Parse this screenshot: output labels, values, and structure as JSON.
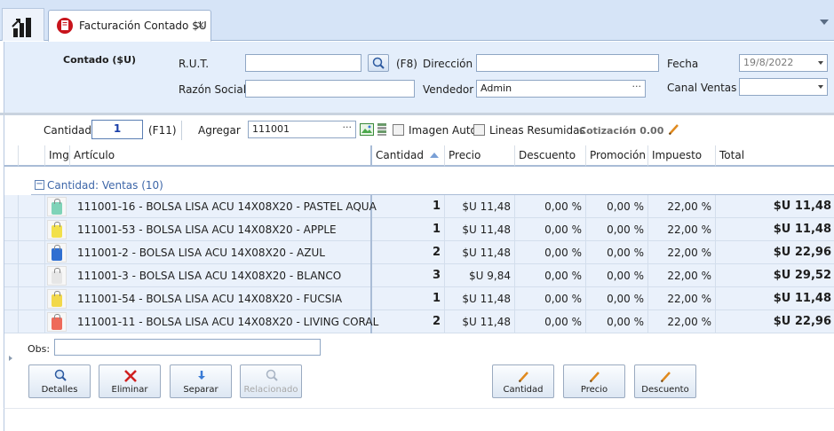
{
  "tab": {
    "label": "Facturación Contado $U",
    "close": "×"
  },
  "header": {
    "mode_label": "Contado ($U)",
    "rut_label": "R.U.T.",
    "rut_value": "",
    "f8_label": "(F8)",
    "direccion_label": "Dirección",
    "direccion_value": "",
    "fecha_label": "Fecha",
    "fecha_value": "19/8/2022",
    "razon_label": "Razón Social",
    "razon_value": "",
    "vendedor_label": "Vendedor",
    "vendedor_value": "Admin",
    "vendedor_dots": "···",
    "canal_label": "Canal Ventas",
    "canal_value": ""
  },
  "entry": {
    "cantidad_label": "Cantidad",
    "cantidad_value": "1",
    "f11_label": "(F11)",
    "agregar_label": "Agregar",
    "agregar_value": "111001",
    "agregar_dots": "···",
    "imagen_auto_label": "Imagen Auto",
    "lineas_label": "Lineas Resumidas",
    "cotizacion_label": "Cotización",
    "cotizacion_value": ": 0.00"
  },
  "grid": {
    "columns": [
      "Img",
      "Artículo",
      "Cantidad",
      "Precio",
      "Descuento",
      "Promoción",
      "Impuesto",
      "Total"
    ],
    "group_label": "Cantidad: Ventas (10)",
    "group_toggle": "−",
    "rows": [
      {
        "article": "111001-16 - BOLSA LISA ACU 14X08X20 - PASTEL AQUA",
        "qty": "1",
        "price": "$U 11,48",
        "discount": "0,00 %",
        "promo": "0,00 %",
        "tax": "22,00 %",
        "total": "$U 11,48",
        "color": "#7fd3b8"
      },
      {
        "article": "111001-53 - BOLSA LISA ACU 14X08X20 - APPLE",
        "qty": "1",
        "price": "$U 11,48",
        "discount": "0,00 %",
        "promo": "0,00 %",
        "tax": "22,00 %",
        "total": "$U 11,48",
        "color": "#f2e04a"
      },
      {
        "article": "111001-2 - BOLSA LISA ACU 14X08X20 - AZUL",
        "qty": "2",
        "price": "$U 11,48",
        "discount": "0,00 %",
        "promo": "0,00 %",
        "tax": "22,00 %",
        "total": "$U 22,96",
        "color": "#2f6fd1"
      },
      {
        "article": "111001-3 - BOLSA LISA ACU 14X08X20 - BLANCO",
        "qty": "3",
        "price": "$U 9,84",
        "discount": "0,00 %",
        "promo": "0,00 %",
        "tax": "22,00 %",
        "total": "$U 29,52",
        "color": "#e6e6e6"
      },
      {
        "article": "111001-54 - BOLSA LISA ACU 14X08X20 - FUCSIA",
        "qty": "1",
        "price": "$U 11,48",
        "discount": "0,00 %",
        "promo": "0,00 %",
        "tax": "22,00 %",
        "total": "$U 11,48",
        "color": "#f2d84a"
      },
      {
        "article": "111001-11 - BOLSA LISA ACU 14X08X20 - LIVING CORAL",
        "qty": "2",
        "price": "$U 11,48",
        "discount": "0,00 %",
        "promo": "0,00 %",
        "tax": "22,00 %",
        "total": "$U 22,96",
        "color": "#ee6a5a"
      }
    ]
  },
  "obs": {
    "label": "Obs:",
    "value": ""
  },
  "buttons": {
    "detalles": "Detalles",
    "eliminar": "Eliminar",
    "separar": "Separar",
    "relacionado": "Relacionado",
    "cantidad": "Cantidad",
    "precio": "Precio",
    "descuento": "Descuento"
  },
  "colors": {
    "accent": "#3d66a8",
    "row_bg": "#eaf1fb",
    "header_bg": "#e4eefb",
    "delete_red": "#d02020"
  },
  "icons": [
    "app-chart-icon",
    "billing-tab-icon",
    "search-icon",
    "picture-icon",
    "stack-icon",
    "pencil-icon",
    "magnifier-icon",
    "delete-x-icon",
    "split-arrow-icon"
  ]
}
